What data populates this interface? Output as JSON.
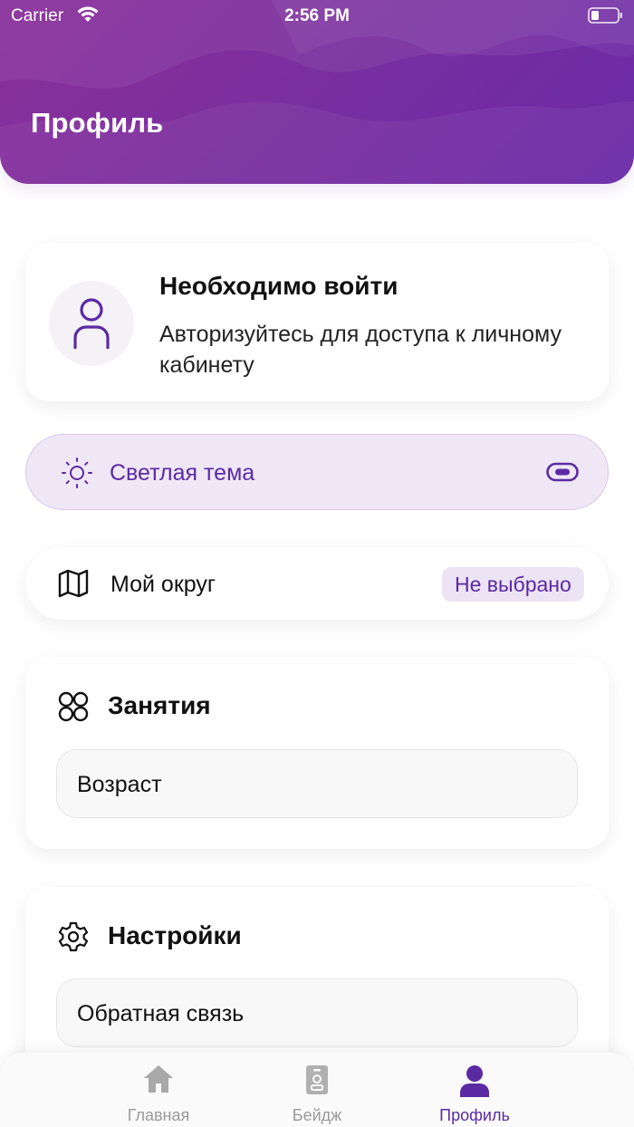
{
  "status_bar": {
    "carrier": "Carrier",
    "time": "2:56 PM"
  },
  "header": {
    "title": "Профиль"
  },
  "login_card": {
    "title": "Необходимо войти",
    "subtitle": "Авторизуйтесь для доступа к личному кабинету"
  },
  "theme_row": {
    "label": "Светлая тема",
    "icon": "sun-icon",
    "toggle_icon": "toggle-icon"
  },
  "district_row": {
    "label": "Мой округ",
    "value": "Не выбрано",
    "icon": "map-icon"
  },
  "classes_section": {
    "title": "Занятия",
    "icon": "grid-circles-icon",
    "items": [
      {
        "label": "Возраст"
      }
    ]
  },
  "settings_section": {
    "title": "Настройки",
    "icon": "gear-icon",
    "items": [
      {
        "label": "Обратная связь"
      }
    ]
  },
  "tabbar": {
    "items": [
      {
        "label": "Главная",
        "icon": "home-icon"
      },
      {
        "label": "Бейдж",
        "icon": "badge-icon"
      },
      {
        "label": "Профиль",
        "icon": "user-icon"
      }
    ],
    "active": "Профиль"
  },
  "colors": {
    "header_gradient_start": "#8a2f9a",
    "header_gradient_end": "#6a2aa8",
    "accent": "#5b2aa3",
    "accent_light": "#efe7f6",
    "tab_inactive": "#9a9a9a"
  }
}
